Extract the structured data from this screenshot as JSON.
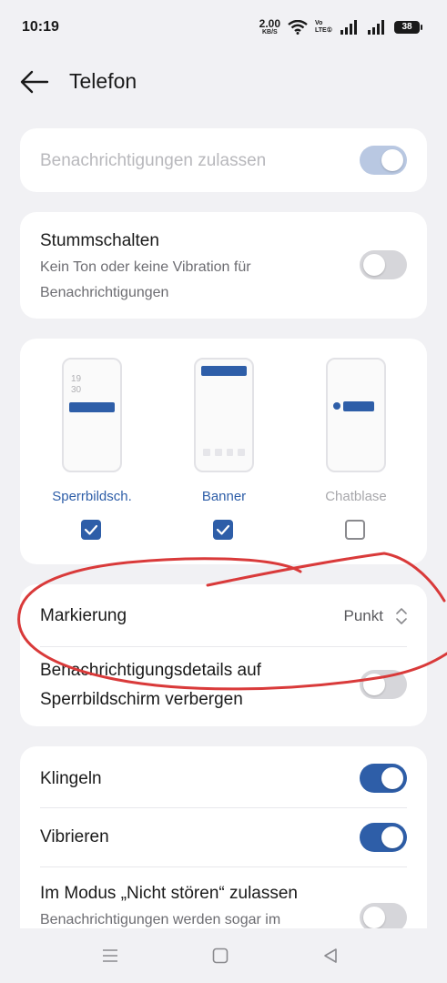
{
  "status": {
    "time": "10:19",
    "net_speed_value": "2.00",
    "net_speed_unit": "KB/S",
    "volte_top": "Vo",
    "volte_bottom": "LTE①",
    "battery": "38"
  },
  "header": {
    "title": "Telefon"
  },
  "allow_card": {
    "label": "Benachrichtigungen zulassen",
    "enabled": true,
    "disabled": true
  },
  "mute_card": {
    "title": "Stummschalten",
    "subtitle_line1": "Kein Ton oder keine Vibration für",
    "subtitle_line2": "Benachrichtigungen",
    "enabled": false
  },
  "styles_card": {
    "options": [
      {
        "label": "Sperrbildsch.",
        "checked": true,
        "clock_top": "19",
        "clock_bottom": "30"
      },
      {
        "label": "Banner",
        "checked": true
      },
      {
        "label": "Chatblase",
        "checked": false
      }
    ]
  },
  "marking_card": {
    "marking_label": "Markierung",
    "marking_value": "Punkt",
    "hide_details_line1": "Benachrichtigungsdetails auf",
    "hide_details_line2": "Sperrbildschirm verbergen",
    "hide_details_enabled": false
  },
  "sound_card": {
    "ring_label": "Klingeln",
    "ring_enabled": true,
    "vibrate_label": "Vibrieren",
    "vibrate_enabled": true,
    "dnd_label": "Im Modus „Nicht stören“ zulassen",
    "dnd_sub": "Benachrichtigungen werden sogar im",
    "dnd_enabled": false
  },
  "colors": {
    "accent": "#2e5ea8",
    "annotation": "#d93a3a"
  },
  "icons": [
    "back-arrow-icon",
    "wifi-icon",
    "signal-icon",
    "battery-icon",
    "chevron-updown-icon",
    "check-icon",
    "menu-icon",
    "home-icon",
    "back-triangle-icon"
  ]
}
